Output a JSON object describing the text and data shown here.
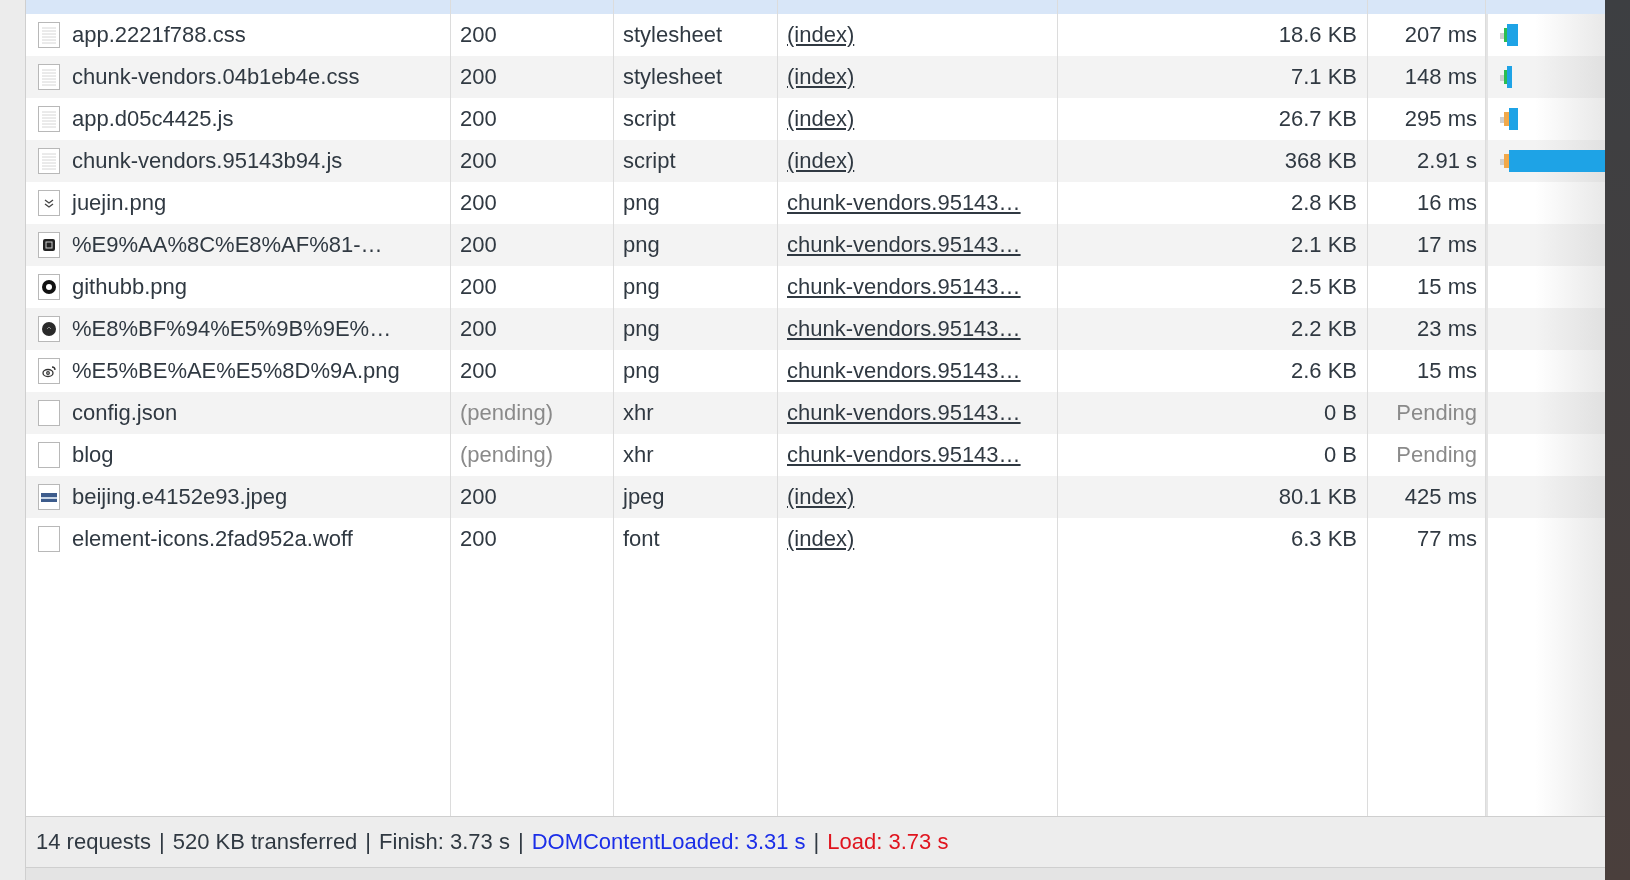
{
  "partial_row": {
    "selected": true
  },
  "requests": [
    {
      "name": "app.2221f788.css",
      "kind": "document",
      "status": "200",
      "pending": false,
      "type": "stylesheet",
      "initiator": "(index)",
      "size": "18.6 KB",
      "time": "207 ms",
      "selected": false
    },
    {
      "name": "chunk-vendors.04b1eb4e.css",
      "kind": "document",
      "status": "200",
      "pending": false,
      "type": "stylesheet",
      "initiator": "(index)",
      "size": "7.1 KB",
      "time": "148 ms",
      "selected": false
    },
    {
      "name": "app.d05c4425.js",
      "kind": "document",
      "status": "200",
      "pending": false,
      "type": "script",
      "initiator": "(index)",
      "size": "26.7 KB",
      "time": "295 ms",
      "selected": false
    },
    {
      "name": "chunk-vendors.95143b94.js",
      "kind": "document",
      "status": "200",
      "pending": false,
      "type": "script",
      "initiator": "(index)",
      "size": "368 KB",
      "time": "2.91 s",
      "selected": false
    },
    {
      "name": "juejin.png",
      "kind": "chevrons",
      "status": "200",
      "pending": false,
      "type": "png",
      "initiator": "chunk-vendors.95143…",
      "size": "2.8 KB",
      "time": "16 ms",
      "selected": false
    },
    {
      "name": "%E9%AA%8C%E8%AF%81-…",
      "kind": "square",
      "status": "200",
      "pending": false,
      "type": "png",
      "initiator": "chunk-vendors.95143…",
      "size": "2.1 KB",
      "time": "17 ms",
      "selected": false
    },
    {
      "name": "githubb.png",
      "kind": "ring",
      "status": "200",
      "pending": false,
      "type": "png",
      "initiator": "chunk-vendors.95143…",
      "size": "2.5 KB",
      "time": "15 ms",
      "selected": false
    },
    {
      "name": "%E8%BF%94%E5%9B%9E%…",
      "kind": "circle",
      "status": "200",
      "pending": false,
      "type": "png",
      "initiator": "chunk-vendors.95143…",
      "size": "2.2 KB",
      "time": "23 ms",
      "selected": false
    },
    {
      "name": "%E5%BE%AE%E5%8D%9A.png",
      "kind": "eye",
      "status": "200",
      "pending": false,
      "type": "png",
      "initiator": "chunk-vendors.95143…",
      "size": "2.6 KB",
      "time": "15 ms",
      "selected": false
    },
    {
      "name": "config.json",
      "kind": "blank",
      "status": "(pending)",
      "pending": true,
      "type": "xhr",
      "initiator": "chunk-vendors.95143…",
      "size": "0 B",
      "time": "Pending",
      "selected": false
    },
    {
      "name": "blog",
      "kind": "blank",
      "status": "(pending)",
      "pending": true,
      "type": "xhr",
      "initiator": "chunk-vendors.95143…",
      "size": "0 B",
      "time": "Pending",
      "selected": false
    },
    {
      "name": "beijing.e4152e93.jpeg",
      "kind": "landscape",
      "status": "200",
      "pending": false,
      "type": "jpeg",
      "initiator": "(index)",
      "size": "80.1 KB",
      "time": "425 ms",
      "selected": false
    },
    {
      "name": "element-icons.2fad952a.woff",
      "kind": "blank",
      "status": "200",
      "pending": false,
      "type": "font",
      "initiator": "(index)",
      "size": "6.3 KB",
      "time": "77 ms",
      "selected": false
    }
  ],
  "status_bar": {
    "separator": "|",
    "items": [
      {
        "text": "14 requests",
        "kind": "plain"
      },
      {
        "text": "520 KB transferred",
        "kind": "plain"
      },
      {
        "text": "Finish: 3.73 s",
        "kind": "plain"
      },
      {
        "text": "DOMContentLoaded: 3.31 s",
        "kind": "dom"
      },
      {
        "text": "Load: 3.73 s",
        "kind": "load"
      }
    ]
  }
}
